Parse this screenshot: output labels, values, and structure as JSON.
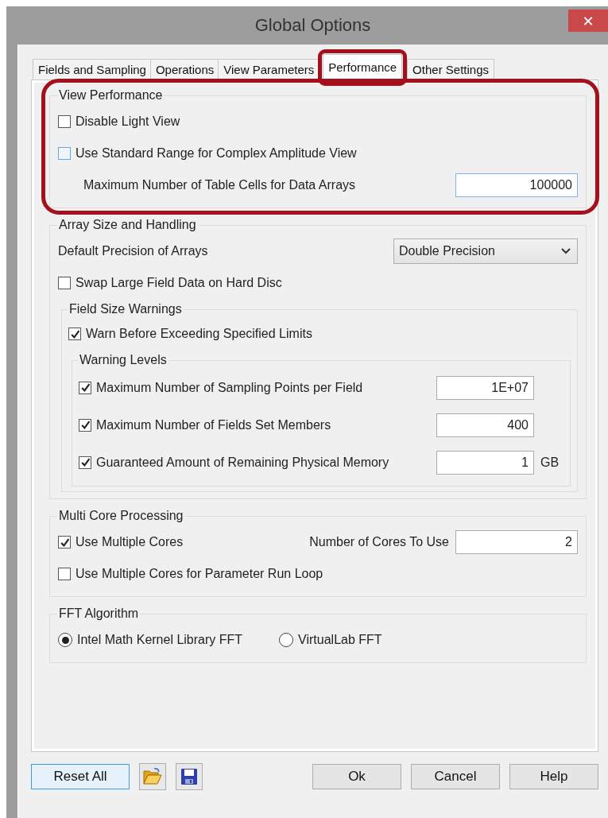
{
  "window": {
    "title": "Global Options",
    "close": "✕"
  },
  "tabs": [
    {
      "label": "Fields and Sampling",
      "selected": false,
      "highlighted": false
    },
    {
      "label": "Operations",
      "selected": false,
      "highlighted": false
    },
    {
      "label": "View Parameters",
      "selected": false,
      "highlighted": false
    },
    {
      "label": "Performance",
      "selected": true,
      "highlighted": true
    },
    {
      "label": "Other Settings",
      "selected": false,
      "highlighted": false
    }
  ],
  "groups": [
    {
      "title": "View Performance",
      "highlighted": true,
      "items": [
        {
          "kind": "checkbox",
          "label": "Disable Light View",
          "checked": false
        },
        {
          "kind": "checkbox",
          "label": "Use Standard Range for Complex Amplitude View",
          "checked": false,
          "hovered": true
        },
        {
          "kind": "number",
          "label": "Maximum Number of Table Cells for Data Arrays",
          "value": "100000"
        }
      ]
    },
    {
      "title": "Array Size and Handling",
      "highlighted": false,
      "items": [
        {
          "kind": "select",
          "label": "Default Precision of Arrays",
          "value": "Double Precision"
        },
        {
          "kind": "checkbox",
          "label": "Swap Large Field Data on Hard Disc",
          "checked": false
        },
        {
          "kind": "group",
          "title": "Field Size Warnings",
          "items": [
            {
              "kind": "checkbox",
              "label": "Warn Before Exceeding Specified Limits",
              "checked": true
            },
            {
              "kind": "group",
              "title": "Warning Levels",
              "items": [
                {
                  "kind": "limit",
                  "label": "Maximum Number of Sampling Points per Field",
                  "checked": true,
                  "value": "1E+07"
                },
                {
                  "kind": "limit",
                  "label": "Maximum Number of Fields Set Members",
                  "checked": true,
                  "value": "400"
                },
                {
                  "kind": "limit",
                  "label": "Guaranteed Amount of Remaining Physical Memory",
                  "checked": true,
                  "value": "1",
                  "unit": "GB"
                }
              ]
            }
          ]
        }
      ]
    },
    {
      "title": "Multi Core Processing",
      "highlighted": false,
      "items": [
        {
          "kind": "checkbox_number",
          "label": "Use Multiple Cores",
          "checked": true,
          "field_label": "Number of Cores To Use",
          "value": "2"
        },
        {
          "kind": "checkbox",
          "label": "Use Multiple Cores for Parameter Run Loop",
          "checked": false
        }
      ]
    },
    {
      "title": "FFT Algorithm",
      "highlighted": false,
      "items": [
        {
          "kind": "radios",
          "options": [
            {
              "label": "Intel Math Kernel Library FFT",
              "selected": true
            },
            {
              "label": "VirtualLab FFT",
              "selected": false
            }
          ]
        }
      ]
    }
  ],
  "buttons": {
    "reset": "Reset All",
    "ok": "Ok",
    "cancel": "Cancel",
    "help": "Help"
  }
}
